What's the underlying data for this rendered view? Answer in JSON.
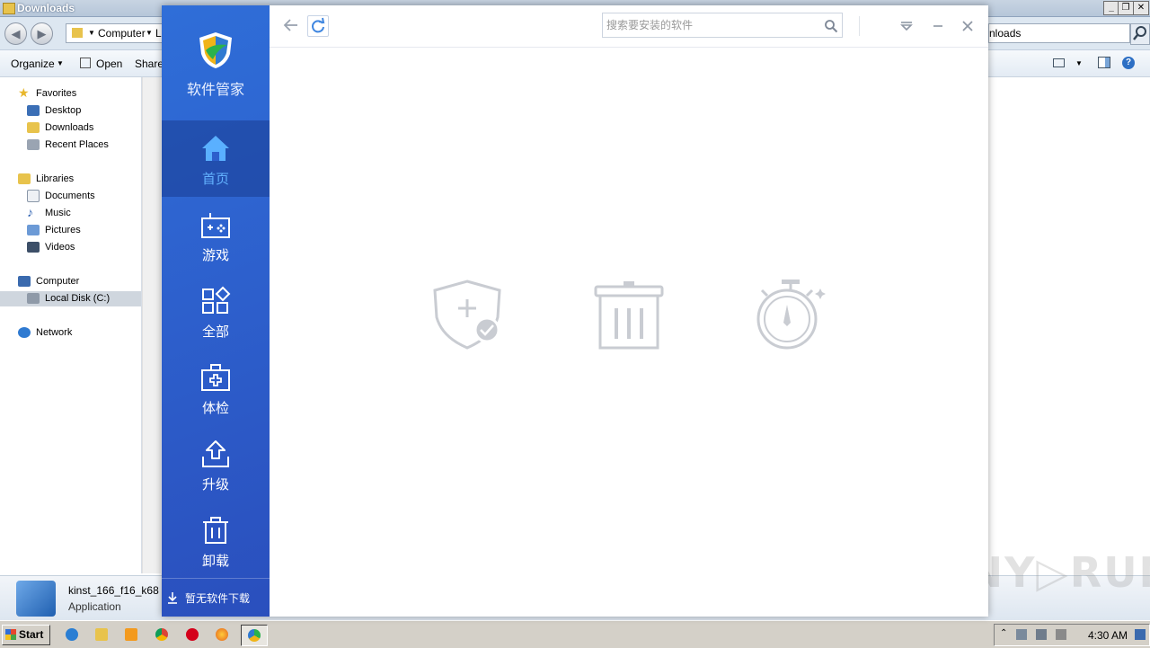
{
  "explorer": {
    "title": "Downloads",
    "address_computer": "Computer",
    "address_tail": "Lo",
    "search_text": "nloads",
    "toolbar": {
      "organize": "Organize",
      "open": "Open",
      "share": "Share"
    },
    "nav": {
      "favorites": "Favorites",
      "desktop": "Desktop",
      "downloads": "Downloads",
      "recent": "Recent Places",
      "libraries": "Libraries",
      "documents": "Documents",
      "music": "Music",
      "pictures": "Pictures",
      "videos": "Videos",
      "computer": "Computer",
      "local_disk": "Local Disk (C:)",
      "network": "Network"
    },
    "details": {
      "name": "kinst_166_f16_k68",
      "type": "Application"
    }
  },
  "app": {
    "brand": "软件管家",
    "search_placeholder": "搜索要安装的软件",
    "nav": [
      {
        "label": "首页",
        "icon": "home-icon"
      },
      {
        "label": "游戏",
        "icon": "gamepad-icon"
      },
      {
        "label": "全部",
        "icon": "apps-grid-icon"
      },
      {
        "label": "体检",
        "icon": "medical-kit-icon"
      },
      {
        "label": "升级",
        "icon": "upload-icon"
      },
      {
        "label": "卸载",
        "icon": "trash-icon"
      }
    ],
    "download_status": "暂无软件下载",
    "colors": {
      "sidebar": "#2d5fcc",
      "active_label": "#63b2ff",
      "icon_gray": "#c9ccd2"
    }
  },
  "taskbar": {
    "start": "Start",
    "clock": "4:30 AM"
  },
  "watermark": "ANY▷RUN"
}
